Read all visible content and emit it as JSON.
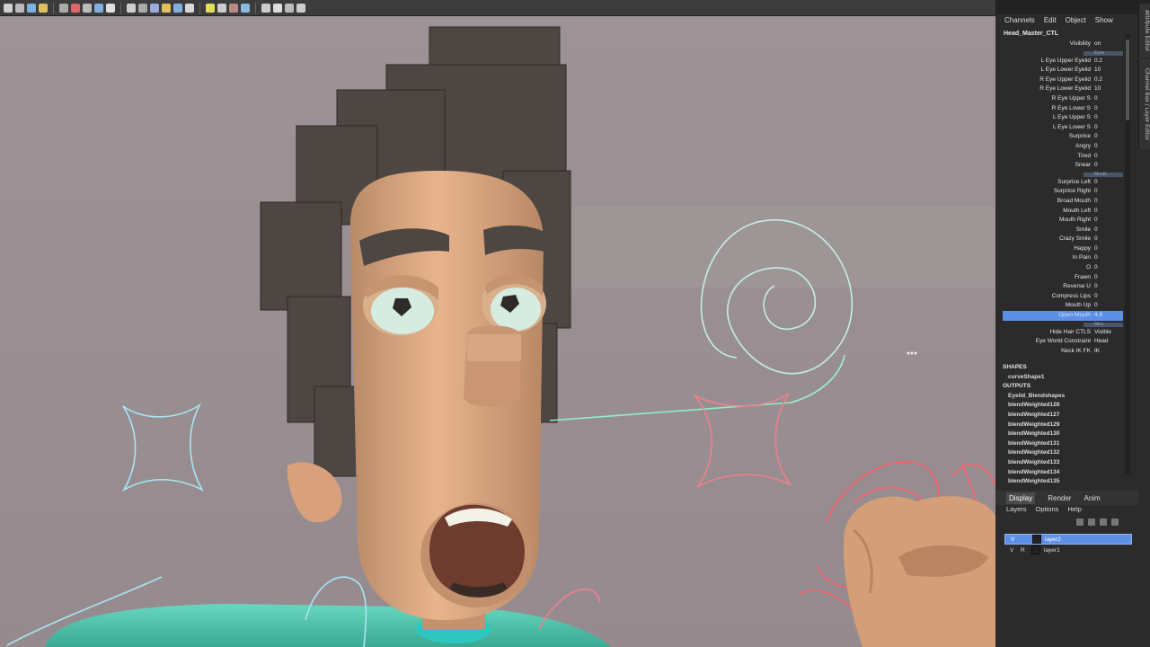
{
  "toolbar": {
    "icons": [
      "select-tool",
      "lasso-tool",
      "paint-tool",
      "move-tool",
      "snap-grid",
      "snap-curve",
      "snap-point",
      "render-view",
      "render-current",
      "ipr-render",
      "render-settings",
      "hypershade",
      "wireframe",
      "smooth-shade",
      "textured",
      "lights",
      "shadows",
      "ambient-occlusion",
      "xray",
      "isolate-select",
      "camera",
      "grid",
      "fullscreen"
    ]
  },
  "channel_box": {
    "menu": [
      "Channels",
      "Edit",
      "Object",
      "Show"
    ],
    "node": "Head_Master_CTL",
    "attributes": [
      {
        "label": "Visibility",
        "value": "on"
      },
      {
        "label": "",
        "value": "Eyes",
        "separator": true
      },
      {
        "label": "L Eye Upper Eyelid",
        "value": "0.2"
      },
      {
        "label": "L Eye Lower Eyelid",
        "value": "10"
      },
      {
        "label": "R Eye Upper Eyelid",
        "value": "0.2"
      },
      {
        "label": "R Eye Lower Eyelid",
        "value": "10"
      },
      {
        "label": "R Eye Upper S",
        "value": "0"
      },
      {
        "label": "R Eye Lower S",
        "value": "0"
      },
      {
        "label": "L Eye Upper S",
        "value": "0"
      },
      {
        "label": "L Eye Lower S",
        "value": "0"
      },
      {
        "label": "Surprice",
        "value": "0"
      },
      {
        "label": "Angry",
        "value": "0"
      },
      {
        "label": "Tired",
        "value": "0"
      },
      {
        "label": "Snear",
        "value": "0"
      },
      {
        "label": "",
        "value": "Mouth",
        "separator": true
      },
      {
        "label": "Surprice Left",
        "value": "0"
      },
      {
        "label": "Surprice Right",
        "value": "0"
      },
      {
        "label": "Broad Mouth",
        "value": "0"
      },
      {
        "label": "Mouth Left",
        "value": "0"
      },
      {
        "label": "Mouth Right",
        "value": "0"
      },
      {
        "label": "Smile",
        "value": "0"
      },
      {
        "label": "Crazy Smile",
        "value": "0"
      },
      {
        "label": "Happy",
        "value": "0"
      },
      {
        "label": "In Pain",
        "value": "0"
      },
      {
        "label": "O",
        "value": "0"
      },
      {
        "label": "Frawn",
        "value": "0"
      },
      {
        "label": "Reverse U",
        "value": "0"
      },
      {
        "label": "Compress Lips",
        "value": "0"
      },
      {
        "label": "Mouth Up",
        "value": "0"
      },
      {
        "label": "Open Mouth",
        "value": "4.8",
        "highlight": true
      },
      {
        "label": "",
        "value": "Misc",
        "separator": true
      },
      {
        "label": "Hide Hair CTLS",
        "value": "Visible"
      },
      {
        "label": "Eye World Constraint",
        "value": "Head"
      },
      {
        "label": "Neck IK FK",
        "value": "IK"
      }
    ],
    "shapes_header": "SHAPES",
    "shapes": [
      "curveShape1"
    ],
    "outputs_header": "OUTPUTS",
    "outputs": [
      "Eyelid_Blendshapes",
      "blendWeighted128",
      "blendWeighted127",
      "blendWeighted129",
      "blendWeighted130",
      "blendWeighted131",
      "blendWeighted132",
      "blendWeighted133",
      "blendWeighted134",
      "blendWeighted135"
    ]
  },
  "side_tabs": {
    "attribute_editor": "Attribute Editor",
    "channel_box": "Channel Box / Layer Editor"
  },
  "layer_editor": {
    "tabs": [
      "Display",
      "Render",
      "Anim"
    ],
    "menu": [
      "Layers",
      "Options",
      "Help"
    ],
    "layers": [
      {
        "vis": "V",
        "type": "",
        "name": "layer2",
        "selected": true
      },
      {
        "vis": "V",
        "type": "R",
        "name": "layer1",
        "selected": false
      }
    ]
  }
}
